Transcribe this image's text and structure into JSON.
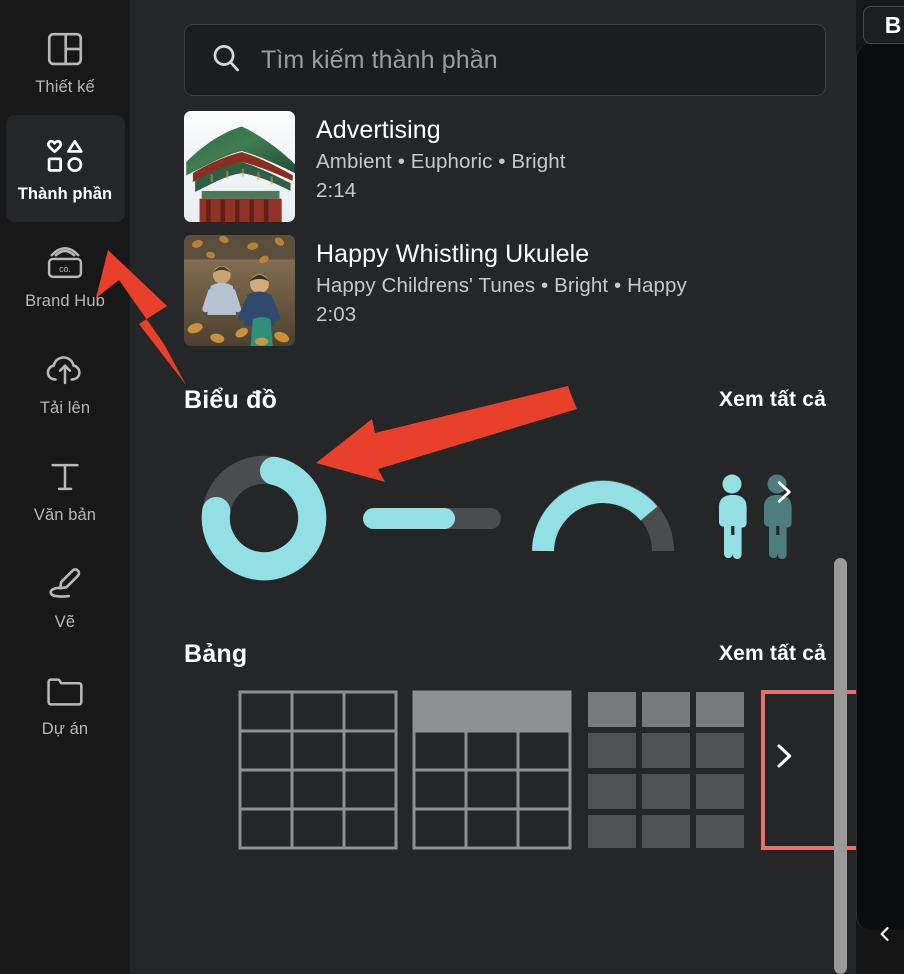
{
  "colors": {
    "rail_bg": "#181818",
    "panel_bg": "#252627",
    "active_bg": "#252627",
    "accent_teal": "#92E0E3",
    "accent_teal_dark": "#4a4d50",
    "annotation_red": "#E8402A",
    "table_red": "#E8706A",
    "text_primary": "#ffffff",
    "text_muted": "#c6c8ca",
    "scrollbar": "#9a9a9a"
  },
  "sidebar": {
    "items": [
      {
        "id": "design",
        "label": "Thiết kế",
        "icon": "layout-icon",
        "active": false
      },
      {
        "id": "elements",
        "label": "Thành phần",
        "icon": "shapes-icon",
        "active": true
      },
      {
        "id": "brandhub",
        "label": "Brand Hub",
        "icon": "brand-card-icon",
        "active": false
      },
      {
        "id": "uploads",
        "label": "Tải lên",
        "icon": "cloud-up-icon",
        "active": false
      },
      {
        "id": "text",
        "label": "Văn bản",
        "icon": "text-t-icon",
        "active": false
      },
      {
        "id": "draw",
        "label": "Vẽ",
        "icon": "pen-icon",
        "active": false
      },
      {
        "id": "projects",
        "label": "Dự án",
        "icon": "folder-icon",
        "active": false
      }
    ]
  },
  "search": {
    "placeholder": "Tìm kiếm thành phần",
    "value": "",
    "icon": "search-icon"
  },
  "audio": {
    "items": [
      {
        "title": "Advertising",
        "tags": "Ambient • Euphoric • Bright",
        "duration": "2:14",
        "thumb": "korean-temple-photo"
      },
      {
        "title": "Happy Whistling Ukulele",
        "tags": "Happy Childrens' Tunes • Bright • Happy",
        "duration": "2:03",
        "thumb": "children-autumn-leaves-photo"
      }
    ]
  },
  "sections": [
    {
      "id": "charts",
      "title": "Biểu đồ",
      "see_all_label": "Xem tất cả",
      "next_icon": "chevron-right-icon",
      "items": [
        {
          "id": "donut",
          "name": "donut-chart-thumb",
          "filled_pct": 74
        },
        {
          "id": "progressbar",
          "name": "progress-bar-thumb",
          "filled_pct": 66
        },
        {
          "id": "gauge",
          "name": "gauge-chart-thumb",
          "filled_pct": 80
        },
        {
          "id": "pictogram",
          "name": "pictogram-chart-thumb",
          "filled_pct": 50
        }
      ]
    },
    {
      "id": "tables",
      "title": "Bảng",
      "see_all_label": "Xem tất cả",
      "next_icon": "chevron-right-icon",
      "items": [
        {
          "id": "plain-grid",
          "name": "table-plain-grid-thumb",
          "cols": 3,
          "rows": 4,
          "style": "outline"
        },
        {
          "id": "header-grid",
          "name": "table-header-grid-thumb",
          "cols": 3,
          "rows": 4,
          "style": "light-header"
        },
        {
          "id": "filled-grid",
          "name": "table-filled-grid-thumb",
          "cols": 3,
          "rows": 4,
          "style": "filled"
        },
        {
          "id": "red-grid",
          "name": "table-red-grid-thumb",
          "cols": 3,
          "rows": 4,
          "style": "red-outline"
        }
      ]
    }
  ],
  "right_panel": {
    "bold_button_label": "B",
    "collapse_icon": "chevron-left-icon"
  },
  "annotations": [
    {
      "id": "arrow-to-elements",
      "points_to": "Thành phần",
      "color": "#E8402A"
    },
    {
      "id": "arrow-to-charts",
      "points_to": "Biểu đồ",
      "color": "#E8402A"
    }
  ]
}
